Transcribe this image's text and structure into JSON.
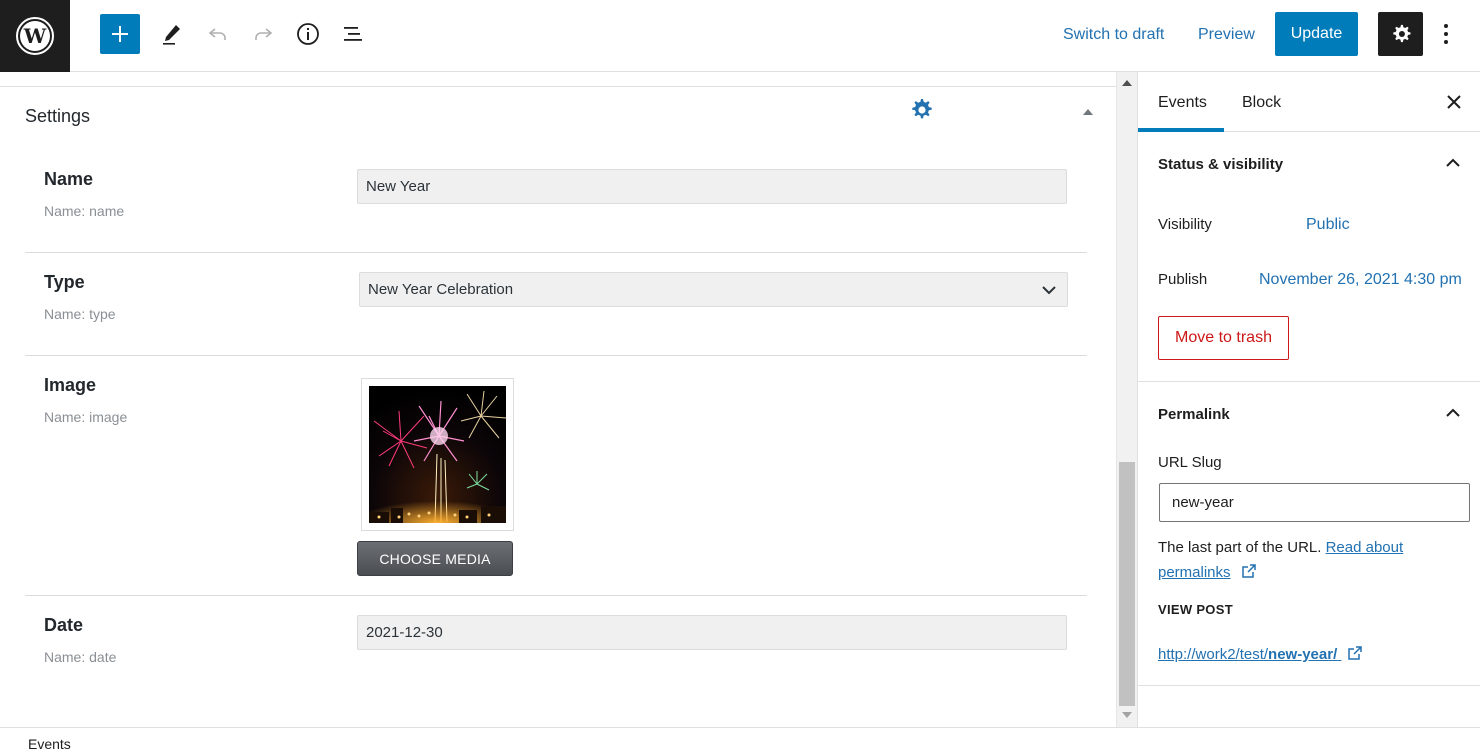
{
  "toolbar": {
    "switch_to_draft": "Switch to draft",
    "preview": "Preview",
    "update": "Update"
  },
  "editor": {
    "settings_title": "Settings",
    "fields": [
      {
        "label": "Name",
        "sub": "Name: name",
        "value": "New Year"
      },
      {
        "label": "Type",
        "sub": "Name: type",
        "value": "New Year Celebration"
      },
      {
        "label": "Image",
        "sub": "Name: image",
        "button": "CHOOSE MEDIA"
      },
      {
        "label": "Date",
        "sub": "Name: date",
        "value": "2021-12-30"
      }
    ]
  },
  "footer": {
    "breadcrumb": "Events"
  },
  "sidebar": {
    "tabs": [
      "Events",
      "Block"
    ],
    "status": {
      "title": "Status & visibility",
      "visibility_label": "Visibility",
      "visibility_value": "Public",
      "publish_label": "Publish",
      "publish_value": "November 26, 2021 4:30 pm",
      "trash": "Move to trash"
    },
    "permalink": {
      "title": "Permalink",
      "slug_label": "URL Slug",
      "slug_value": "new-year",
      "help_prefix": "The last part of the URL.",
      "help_link_1": "Read about",
      "help_link_2": "permalinks",
      "view_post": "VIEW POST",
      "url_base": "http://work2/test/",
      "url_slug": "new-year/"
    }
  },
  "colors": {
    "accent": "#007cba",
    "link": "#2271b1",
    "danger": "#cc1818",
    "dark": "#1e1e1e"
  }
}
